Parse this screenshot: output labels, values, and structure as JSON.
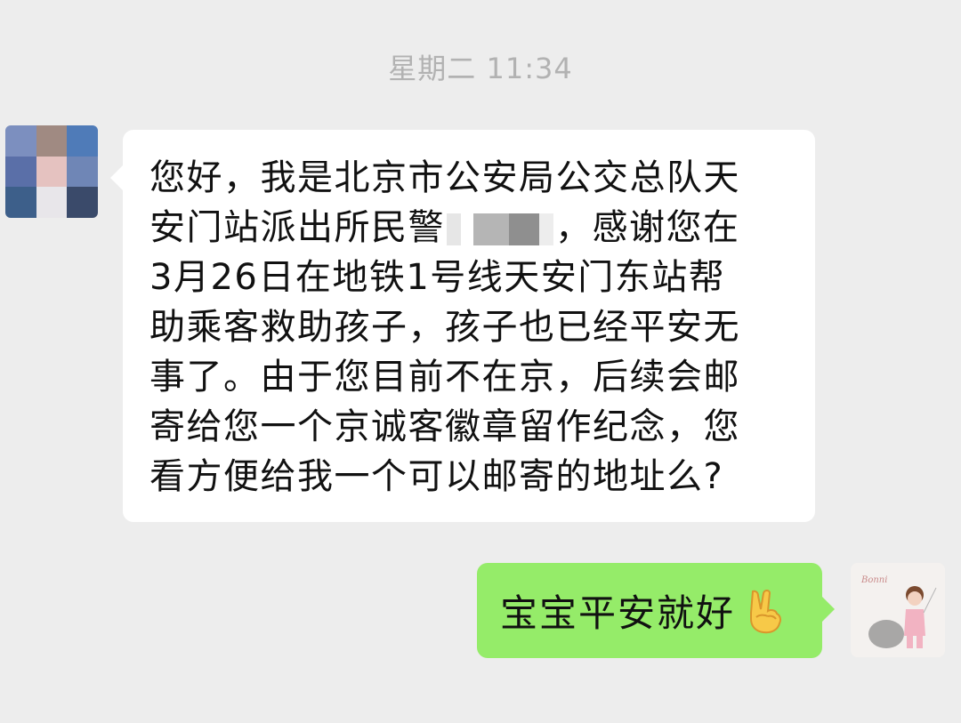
{
  "chat": {
    "timestamp": "星期二 11:34",
    "incoming": {
      "avatar_icon": "pixelated-avatar-icon",
      "avatar_colors": [
        "#7c8fbf",
        "#a08a82",
        "#4f7bb8",
        "#5a6fa8",
        "#e5c2c0",
        "#6f86b6",
        "#3d5f8a",
        "#cfcfd8",
        "#3a4a6a"
      ],
      "lines": {
        "l1": "您好，我是北京市公安局公交总队天",
        "l2_pre": "安门站派出所民警",
        "l2_post": "，感谢您在",
        "l3": "3月26日在地铁1号线天安门东站帮",
        "l4": "助乘客救助孩子，孩子也已经平安无",
        "l5": "事了。由于您目前不在京，后续会邮",
        "l6": "寄给您一个京诚客徽章留作纪念，您",
        "l7": "看方便给我一个可以邮寄的地址么?"
      },
      "redaction_icon": "mosaic-redaction-icon"
    },
    "outgoing": {
      "text": "宝宝平安就好",
      "emoji_icon": "victory-hand-emoji-icon",
      "avatar_icon": "cartoon-girl-avatar-icon",
      "avatar_label": "Bonni"
    }
  },
  "colors": {
    "background": "#ededed",
    "incoming_bubble": "#ffffff",
    "outgoing_bubble": "#95ec69",
    "timestamp": "#b2b2b2",
    "text": "#111111"
  }
}
